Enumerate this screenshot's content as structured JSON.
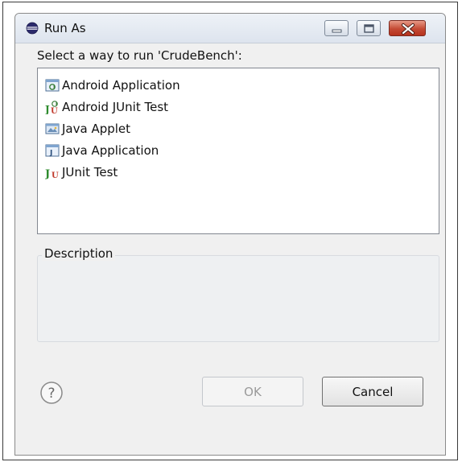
{
  "window": {
    "title": "Run As",
    "icon": "run-as-icon",
    "controls": {
      "minimize": "minimize-icon",
      "maximize": "maximize-icon",
      "close": "close-icon"
    }
  },
  "dialog": {
    "prompt": "Select a way to run 'CrudeBench':",
    "items": [
      {
        "label": "Android Application",
        "icon": "android-application-icon"
      },
      {
        "label": "Android JUnit Test",
        "icon": "android-junit-test-icon"
      },
      {
        "label": "Java Applet",
        "icon": "java-applet-icon"
      },
      {
        "label": "Java Application",
        "icon": "java-application-icon"
      },
      {
        "label": "JUnit Test",
        "icon": "junit-test-icon"
      }
    ],
    "description_label": "Description",
    "description_text": ""
  },
  "buttons": {
    "help_icon": "help-icon",
    "ok_label": "OK",
    "ok_enabled": false,
    "cancel_label": "Cancel"
  },
  "colors": {
    "close_button": "#c44a34",
    "disabled_text": "#9a9a9a"
  }
}
